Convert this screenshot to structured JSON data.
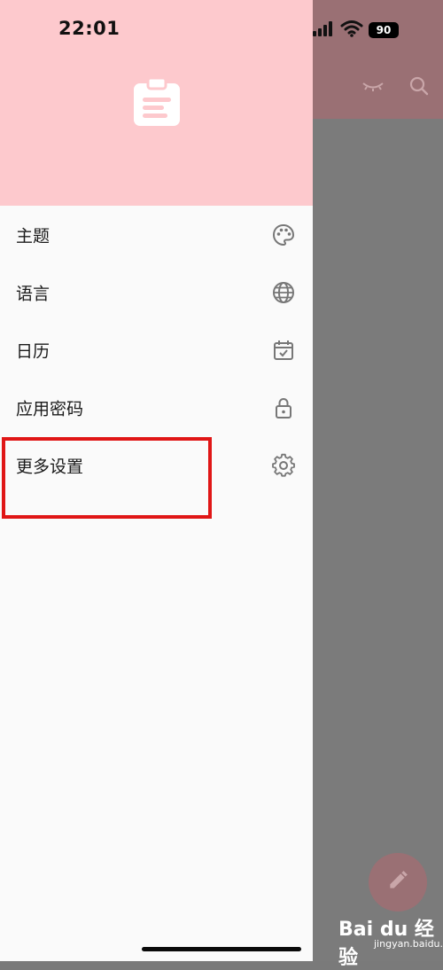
{
  "status_bar": {
    "time": "22:01",
    "battery": "90"
  },
  "drawer": {
    "items": [
      {
        "label": "主题",
        "icon": "palette-icon"
      },
      {
        "label": "语言",
        "icon": "globe-icon"
      },
      {
        "label": "日历",
        "icon": "calendar-check-icon"
      },
      {
        "label": "应用密码",
        "icon": "lock-icon"
      },
      {
        "label": "更多设置",
        "icon": "gear-icon"
      }
    ]
  },
  "colors": {
    "drawer_header": "#fdc9cd",
    "highlight_border": "#e01616",
    "scrim_header": "#9a7074",
    "scrim_body": "#7b7b7b"
  },
  "watermark": {
    "logo": "Bai du 经验",
    "url": "jingyan.baidu.com"
  }
}
